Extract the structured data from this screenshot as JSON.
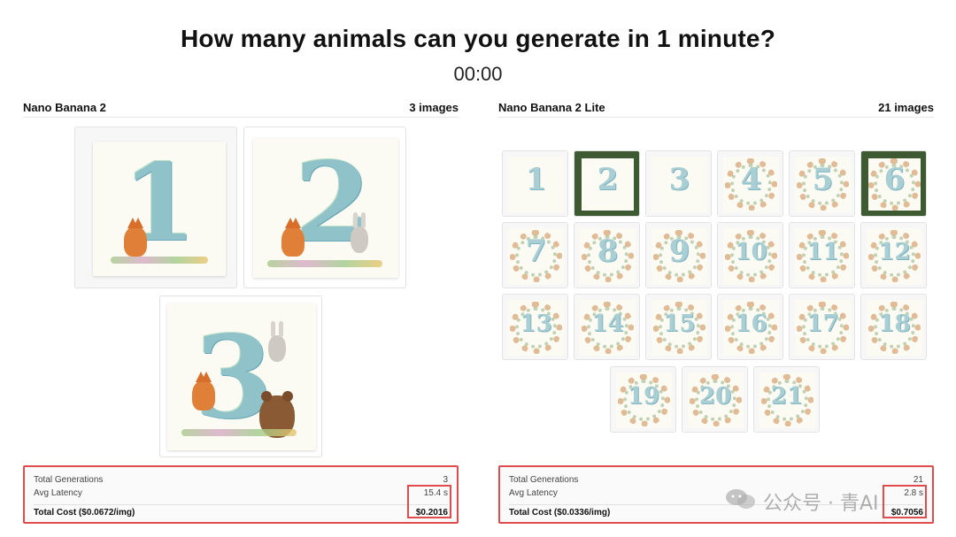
{
  "title": "How many animals can you generate in 1 minute?",
  "timer": "00:00",
  "left": {
    "model": "Nano Banana 2",
    "count_label": "3 images",
    "images": [
      "1",
      "2",
      "3"
    ],
    "stats": {
      "generations_label": "Total Generations",
      "generations_value": "3",
      "latency_label": "Avg Latency",
      "latency_value": "15.4 s",
      "cost_label": "Total Cost ($0.0672/img)",
      "cost_value": "$0.2016"
    }
  },
  "right": {
    "model": "Nano Banana 2 Lite",
    "count_label": "21 images",
    "thumbnails": [
      "1",
      "2",
      "3",
      "4",
      "5",
      "6",
      "7",
      "8",
      "9",
      "10",
      "11",
      "12",
      "13",
      "14",
      "15",
      "16",
      "17",
      "18",
      "19",
      "20",
      "21"
    ],
    "stats": {
      "generations_label": "Total Generations",
      "generations_value": "21",
      "latency_label": "Avg Latency",
      "latency_value": "2.8 s",
      "cost_label": "Total Cost ($0.0336/img)",
      "cost_value": "$0.7056"
    }
  },
  "watermark": "公众号 · 青AI",
  "colors": {
    "highlight": "#e04b4b",
    "numeral": "#8fc3c9",
    "fox": "#e07f37"
  }
}
